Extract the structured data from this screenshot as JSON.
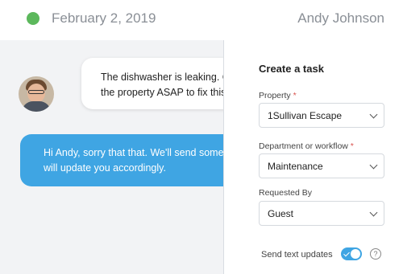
{
  "header": {
    "date": "February 2, 2019",
    "user_name": "Andy Johnson",
    "status_color": "#5cb85c"
  },
  "chat": {
    "incoming": {
      "line1": "The dishwasher is leaking. C",
      "line2": "the property ASAP to fix this"
    },
    "outgoing": {
      "line1": "Hi Andy, sorry that that. We'll send someo",
      "line2": "will update you accordingly."
    }
  },
  "task_panel": {
    "title": "Create a task",
    "property": {
      "label": "Property",
      "required": "*",
      "value": "1Sullivan Escape"
    },
    "department": {
      "label": "Department or workflow",
      "required": "*",
      "value": "Maintenance"
    },
    "requested_by": {
      "label": "Requested By",
      "value": "Guest"
    },
    "send_text_updates": {
      "label": "Send text updates",
      "enabled": true
    },
    "help_glyph": "?"
  },
  "colors": {
    "accent": "#3fa5e3",
    "required": "#d9534f"
  }
}
